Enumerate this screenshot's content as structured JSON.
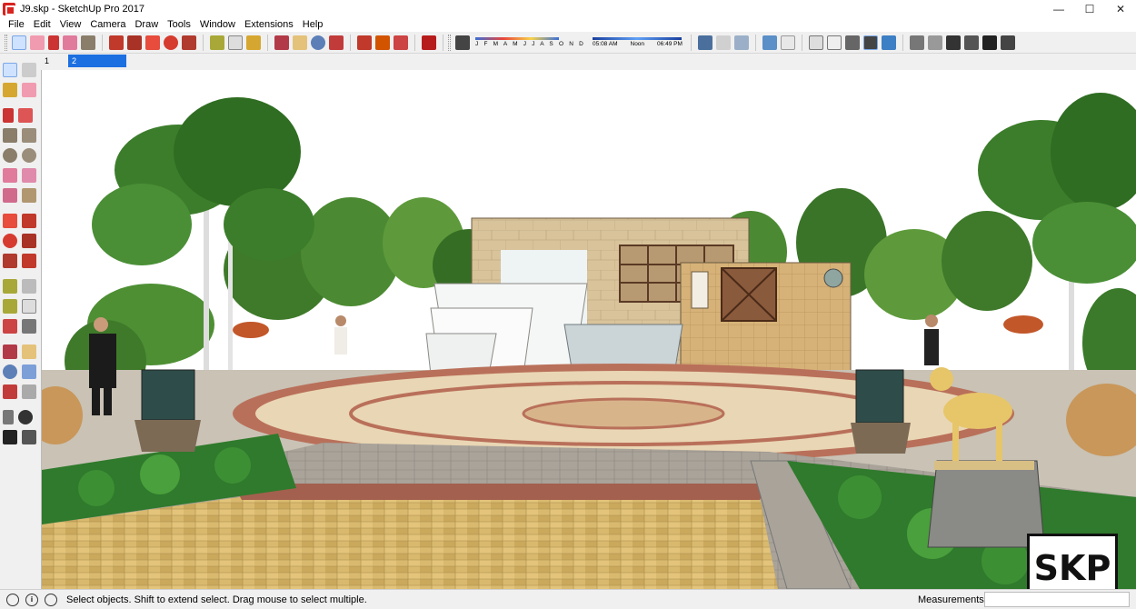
{
  "window": {
    "title": "J9.skp - SketchUp Pro 2017"
  },
  "window_controls": {
    "minimize": "—",
    "maximize": "☐",
    "close": "✕"
  },
  "menu": [
    "File",
    "Edit",
    "View",
    "Camera",
    "Draw",
    "Tools",
    "Window",
    "Extensions",
    "Help"
  ],
  "shadow": {
    "months": "J F M A M J J A S O N D",
    "time_start": "05:08 AM",
    "time_mid": "Noon",
    "time_end": "06:49 PM"
  },
  "scenes": [
    "1",
    "2"
  ],
  "status": {
    "hint": "Select objects. Shift to extend select. Drag mouse to select multiple.",
    "measurements_label": "Measurements",
    "info_icon": "i"
  },
  "badge": {
    "text": "SKP"
  },
  "colors": {
    "scene_tab_active": "#1c6fe0",
    "sky": "#ffffff",
    "app_icon": "#d9231f"
  }
}
